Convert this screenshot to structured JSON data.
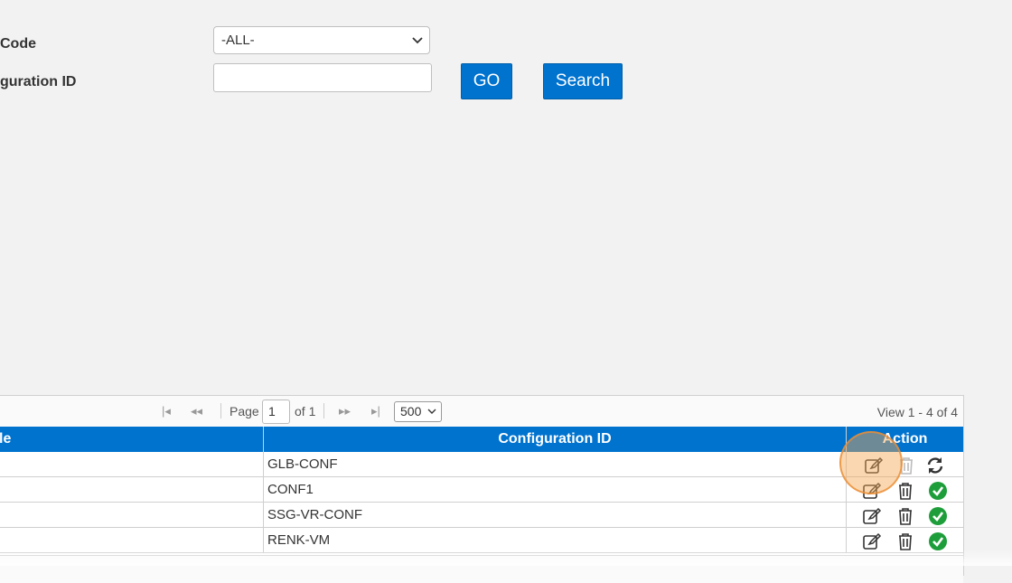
{
  "form": {
    "code_label": "Code",
    "config_id_label": "guration ID",
    "code_select_value": "-ALL-",
    "config_id_value": "",
    "go_label": "GO",
    "search_label": "Search"
  },
  "grid": {
    "pager": {
      "page_label": "Page",
      "page_value": "1",
      "of_label": "of 1",
      "rows_per_page": "500",
      "view_text": "View 1 - 4 of 4"
    },
    "columns": [
      "le",
      "Configuration ID",
      "Action"
    ],
    "rows": [
      {
        "config_id": "GLB-CONF",
        "status_icon": "refresh-icon"
      },
      {
        "config_id": "CONF1",
        "status_icon": "check-circle-icon"
      },
      {
        "config_id": "SSG-VR-CONF",
        "status_icon": "check-circle-icon"
      },
      {
        "config_id": "RENK-VM",
        "status_icon": "check-circle-icon"
      }
    ]
  },
  "colors": {
    "accent": "#0073cf",
    "success": "#1e9e3a",
    "highlight": "#f5a650"
  }
}
